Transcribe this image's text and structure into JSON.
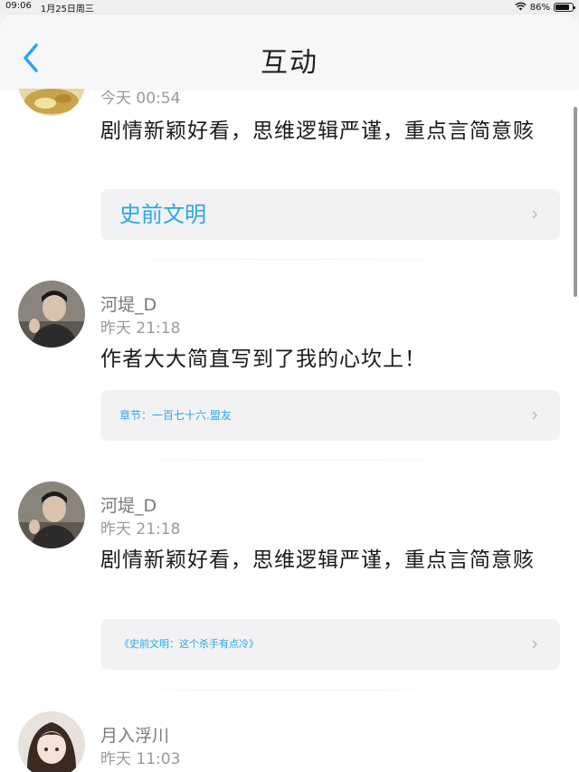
{
  "status_bar": {
    "time": "09:06",
    "date": "1月25日周三",
    "battery": "86%",
    "battery_level": 0.86
  },
  "nav": {
    "title": "互动"
  },
  "items": [
    {
      "time": "今天 00:54",
      "text": "剧情新颖好看，思维逻辑严谨，重点言简意赅",
      "ref": "史前文明"
    },
    {
      "username": "河堤_D",
      "time": "昨天 21:18",
      "text": "作者大大简直写到了我的心坎上！",
      "ref": "章节：一百七十六.盟友"
    },
    {
      "username": "河堤_D",
      "time": "昨天 21:18",
      "text": "剧情新颖好看，思维逻辑严谨，重点言简意赅",
      "ref": "《史前文明：这个杀手有点冷》"
    },
    {
      "username": "月入浮川",
      "time": "昨天 11:03"
    }
  ],
  "colors": {
    "accent": "#2aa6e8",
    "text": "#1a1a1a",
    "muted": "#9a9a9a",
    "ref_bg": "#f2f2f4"
  }
}
